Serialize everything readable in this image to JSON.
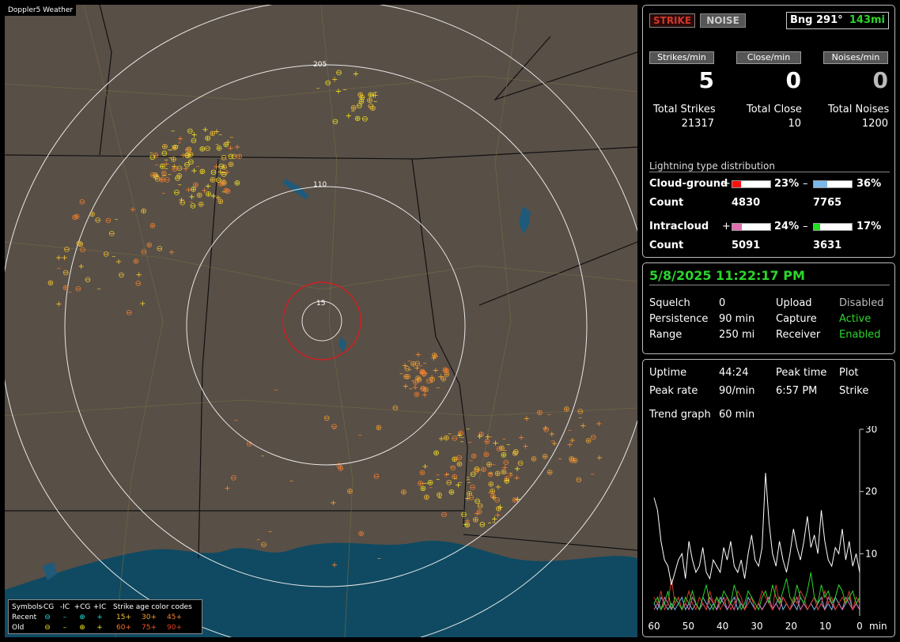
{
  "map": {
    "title": "Doppler5 Weather",
    "ring_labels": [
      "205",
      "110",
      "15"
    ],
    "legend": {
      "header": [
        "Symbols",
        "-CG",
        "-IC",
        "+CG",
        "+IC",
        "Strike age color codes"
      ],
      "recent_label": "Recent",
      "old_label": "Old",
      "recent_ages": [
        "15+",
        "30+",
        "45+"
      ],
      "old_ages": [
        "60+",
        "75+",
        "90+"
      ]
    }
  },
  "status": {
    "strike_btn": "STRIKE",
    "noise_btn": "NOISE",
    "bearing": "Bng 291°",
    "distance": "143mi"
  },
  "rates": {
    "strikes_label": "Strikes/min",
    "close_label": "Close/min",
    "noises_label": "Noises/min",
    "strikes": "5",
    "close": "0",
    "noises": "0"
  },
  "totals": {
    "strikes_label": "Total Strikes",
    "close_label": "Total Close",
    "noises_label": "Total Noises",
    "strikes": "21317",
    "close": "10",
    "noises": "1200"
  },
  "distribution": {
    "title": "Lightning type distribution",
    "cg_label": "Cloud-ground",
    "ic_label": "Intracloud",
    "count_label": "Count",
    "plus": "+",
    "minus": "–",
    "cg_pos_pct": "23%",
    "cg_neg_pct": "36%",
    "ic_pos_pct": "24%",
    "ic_neg_pct": "17%",
    "cg_pos_count": "4830",
    "cg_neg_count": "7765",
    "ic_pos_count": "5091",
    "ic_neg_count": "3631",
    "cg_pos_frac": 0.23,
    "cg_neg_frac": 0.36,
    "ic_pos_frac": 0.24,
    "ic_neg_frac": 0.17
  },
  "settings": {
    "datetime": "5/8/2025 11:22:17 PM",
    "squelch_label": "Squelch",
    "squelch": "0",
    "persistence_label": "Persistence",
    "persistence": "90 min",
    "range_label": "Range",
    "range": "250 mi",
    "upload_label": "Upload",
    "upload": "Disabled",
    "capture_label": "Capture",
    "capture": "Active",
    "receiver_label": "Receiver",
    "receiver": "Enabled"
  },
  "stats": {
    "uptime_label": "Uptime",
    "uptime": "44:24",
    "peak_time_label": "Peak time",
    "peak_time": "6:57 PM",
    "plot_label": "Plot",
    "plot": "Strike",
    "peak_rate_label": "Peak rate",
    "peak_rate": "90/min",
    "trend_label": "Trend graph",
    "trend": "60 min"
  },
  "chart_data": {
    "type": "line",
    "x_ticks": [
      "60",
      "50",
      "40",
      "30",
      "20",
      "10",
      "0"
    ],
    "x_unit": "min",
    "y_ticks": [
      "30",
      "20",
      "10"
    ],
    "ylim": [
      0,
      30
    ],
    "series": [
      {
        "color": "#ffffff",
        "values": [
          19,
          17,
          12,
          9,
          8,
          5,
          7,
          9,
          10,
          6,
          12,
          9,
          7,
          8,
          11,
          7,
          6,
          9,
          8,
          7,
          11,
          9,
          12,
          8,
          7,
          9,
          6,
          10,
          13,
          9,
          8,
          11,
          23,
          15,
          10,
          8,
          12,
          9,
          7,
          10,
          14,
          11,
          9,
          12,
          16,
          11,
          13,
          10,
          17,
          12,
          9,
          8,
          11,
          10,
          14,
          9,
          12,
          8,
          10,
          7
        ]
      },
      {
        "color": "#2bd62b",
        "values": [
          2,
          3,
          1,
          2,
          4,
          1,
          3,
          2,
          1,
          3,
          2,
          4,
          2,
          1,
          3,
          5,
          2,
          1,
          3,
          2,
          4,
          3,
          2,
          5,
          3,
          1,
          2,
          4,
          3,
          2,
          1,
          3,
          4,
          2,
          5,
          3,
          2,
          4,
          6,
          3,
          2,
          5,
          3,
          2,
          4,
          7,
          3,
          2,
          5,
          3,
          4,
          2,
          3,
          5,
          4,
          2,
          3,
          4,
          2,
          3
        ]
      },
      {
        "color": "#d0392b",
        "values": [
          3,
          2,
          4,
          1,
          2,
          6,
          2,
          3,
          1,
          2,
          4,
          2,
          1,
          3,
          2,
          1,
          4,
          2,
          3,
          1,
          2,
          3,
          1,
          2,
          4,
          3,
          1,
          2,
          3,
          1,
          2,
          4,
          3,
          2,
          1,
          5,
          2,
          3,
          2,
          1,
          3,
          2,
          4,
          3,
          1,
          2,
          3,
          1,
          2,
          4,
          2,
          3,
          1,
          2,
          3,
          2,
          4,
          1,
          3,
          2
        ]
      },
      {
        "color": "#e070b0",
        "values": [
          1,
          2,
          1,
          3,
          2,
          1,
          2,
          3,
          1,
          2,
          1,
          3,
          2,
          1,
          2,
          1,
          3,
          2,
          1,
          2,
          3,
          1,
          2,
          1,
          3,
          2,
          1,
          2,
          3,
          1,
          2,
          1,
          2,
          3,
          1,
          2,
          1,
          3,
          2,
          1,
          2,
          3,
          1,
          2,
          1,
          2,
          3,
          1,
          2,
          1,
          3,
          2,
          1,
          2,
          1,
          3,
          2,
          1,
          2,
          1
        ]
      },
      {
        "color": "#7ab8e8",
        "values": [
          2,
          1,
          3,
          2,
          1,
          2,
          1,
          2,
          3,
          1,
          2,
          1,
          2,
          1,
          3,
          2,
          1,
          2,
          1,
          3,
          2,
          1,
          2,
          3,
          1,
          2,
          1,
          3,
          2,
          1,
          2,
          1,
          2,
          3,
          1,
          2,
          3,
          1,
          2,
          1,
          2,
          1,
          3,
          2,
          1,
          2,
          1,
          2,
          3,
          1,
          2,
          1,
          3,
          2,
          1,
          2,
          3,
          1,
          2,
          1
        ]
      }
    ]
  },
  "colors": {
    "cg_pos": "#ff1010",
    "cg_neg": "#7ab8e8",
    "ic_pos": "#e070b0",
    "ic_neg": "#20e020"
  }
}
